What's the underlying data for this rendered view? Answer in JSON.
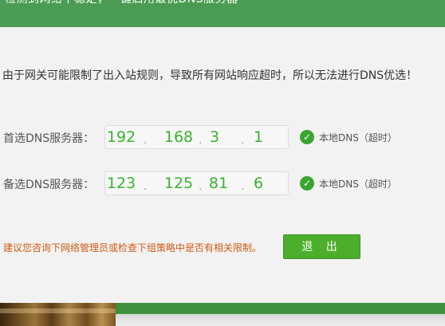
{
  "banner": {
    "title": "检测到网络不稳定，一键启用最优DNS服务器"
  },
  "notice": "由于网关可能限制了出入站规则，导致所有网站响应超时，所以无法进行DNS优选！",
  "dns": {
    "primary": {
      "label": "首选DNS服务器：",
      "octets": [
        "192",
        "168",
        "3",
        "1"
      ],
      "status": "本地DNS（超时）"
    },
    "secondary": {
      "label": "备选DNS服务器：",
      "octets": [
        "123",
        "125",
        "81",
        "6"
      ],
      "status": "本地DNS（超时）"
    }
  },
  "advice": "建议您咨询下网络管理员或检查下组策略中是否有相关限制。",
  "exit_button": "退 出",
  "colors": {
    "accent": "#4cae2b",
    "banner": "#4a9c52",
    "octet": "#3ab12f",
    "warning": "#d05a12"
  },
  "icons": {
    "status": "check-circle-icon"
  }
}
